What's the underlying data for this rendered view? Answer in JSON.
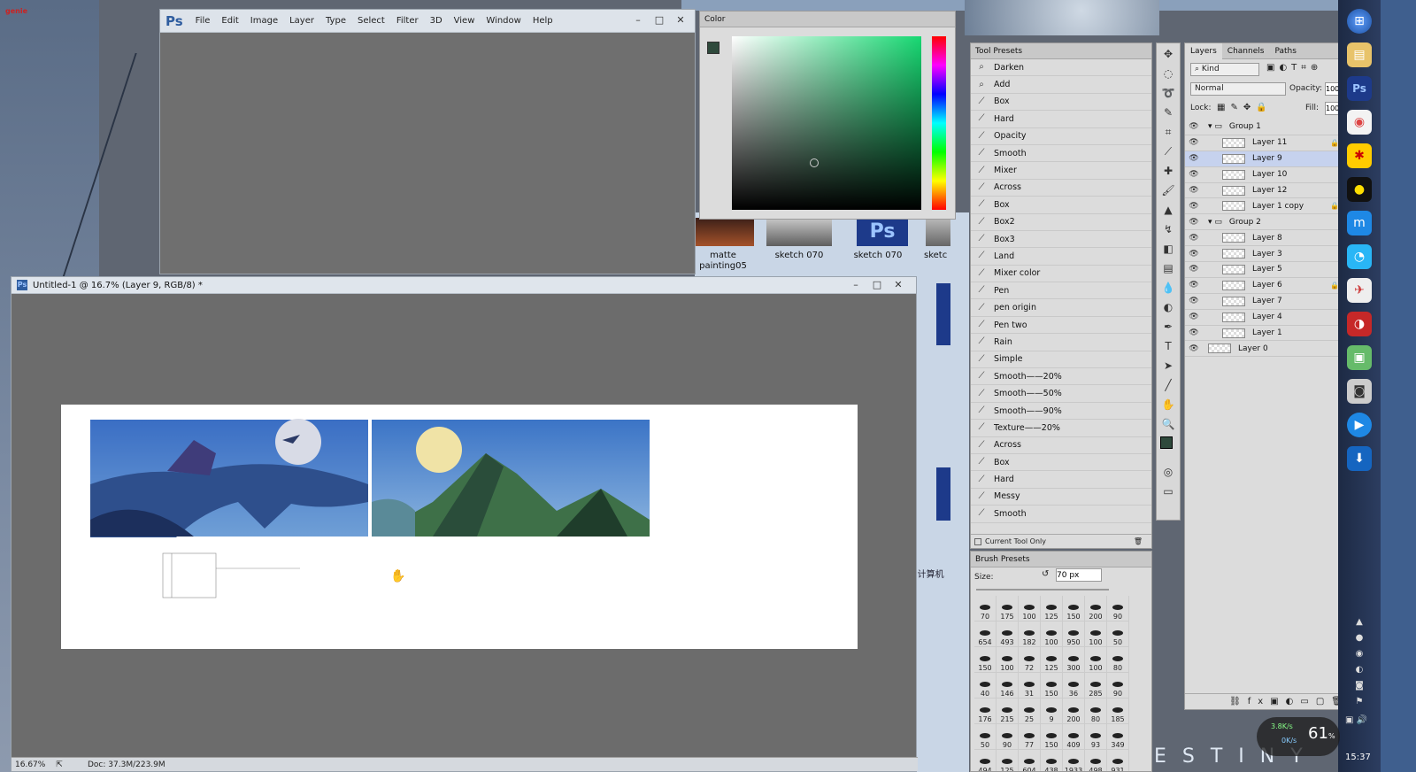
{
  "app": {
    "logo": "Ps",
    "menu": [
      "File",
      "Edit",
      "Image",
      "Layer",
      "Type",
      "Select",
      "Filter",
      "3D",
      "View",
      "Window",
      "Help"
    ],
    "window_buttons": [
      "–",
      "□",
      "✕"
    ]
  },
  "document": {
    "title": "Untitled-1 @ 16.7% (Layer 9, RGB/8) *",
    "zoom": "16.67%",
    "doc_size": "Doc: 37.3M/223.9M"
  },
  "color_panel": {
    "tab": "Color",
    "foreground": "#2f4a3c",
    "background": "#7fb0a0"
  },
  "tool_presets": {
    "tab": "Tool Presets",
    "items": [
      "Darken",
      "Add",
      "Box",
      "Hard",
      "Opacity",
      "Smooth",
      "Mixer",
      "Across",
      "Box",
      "Box2",
      "Box3",
      "Land",
      "Mixer color",
      "Pen",
      "pen origin",
      "Pen two",
      "Rain",
      "Simple",
      "Smooth——20%",
      "Smooth——50%",
      "Smooth——90%",
      "Texture——20%",
      "Across",
      "Box",
      "Hard",
      "Messy",
      "Smooth"
    ],
    "current_tool_only": "Current Tool Only"
  },
  "brush_presets": {
    "tab": "Brush Presets",
    "size_label": "Size:",
    "size_value": "70 px",
    "sizes": [
      "70",
      "175",
      "100",
      "125",
      "150",
      "200",
      "90",
      "654",
      "493",
      "182",
      "100",
      "950",
      "100",
      "50",
      "150",
      "100",
      "72",
      "125",
      "300",
      "100",
      "80",
      "40",
      "146",
      "31",
      "150",
      "36",
      "285",
      "90",
      "176",
      "215",
      "25",
      "9",
      "200",
      "80",
      "185",
      "50",
      "90",
      "77",
      "150",
      "409",
      "93",
      "349",
      "494",
      "125",
      "604",
      "438",
      "1933",
      "498",
      "931"
    ]
  },
  "layers_panel": {
    "tabs": [
      "Layers",
      "Channels",
      "Paths"
    ],
    "kind": "Kind",
    "blend_mode": "Normal",
    "opacity_label": "Opacity:",
    "opacity_value": "100%",
    "lock_label": "Lock:",
    "fill_label": "Fill:",
    "fill_value": "100%",
    "rows": [
      {
        "name": "Group 1",
        "group": true
      },
      {
        "name": "Layer 11",
        "lock": true
      },
      {
        "name": "Layer 9",
        "selected": true
      },
      {
        "name": "Layer 10"
      },
      {
        "name": "Layer 12"
      },
      {
        "name": "Layer 1 copy",
        "lock": true
      },
      {
        "name": "Group 2",
        "group": true
      },
      {
        "name": "Layer 8"
      },
      {
        "name": "Layer 3"
      },
      {
        "name": "Layer 5"
      },
      {
        "name": "Layer 6",
        "lock": true
      },
      {
        "name": "Layer 7"
      },
      {
        "name": "Layer 4"
      },
      {
        "name": "Layer 1"
      },
      {
        "name": "Layer 0",
        "base": true
      }
    ]
  },
  "explorer": {
    "thumbs": [
      "matte painting05",
      "sketch 070",
      "sketch 070",
      "sketc"
    ],
    "computer_label": "计算机"
  },
  "net": {
    "up": "3.8K/s",
    "down": "0K/s",
    "percent": "61",
    "percent_unit": "%"
  },
  "clock": "15:37",
  "wallpaper_text": "ESTINY"
}
